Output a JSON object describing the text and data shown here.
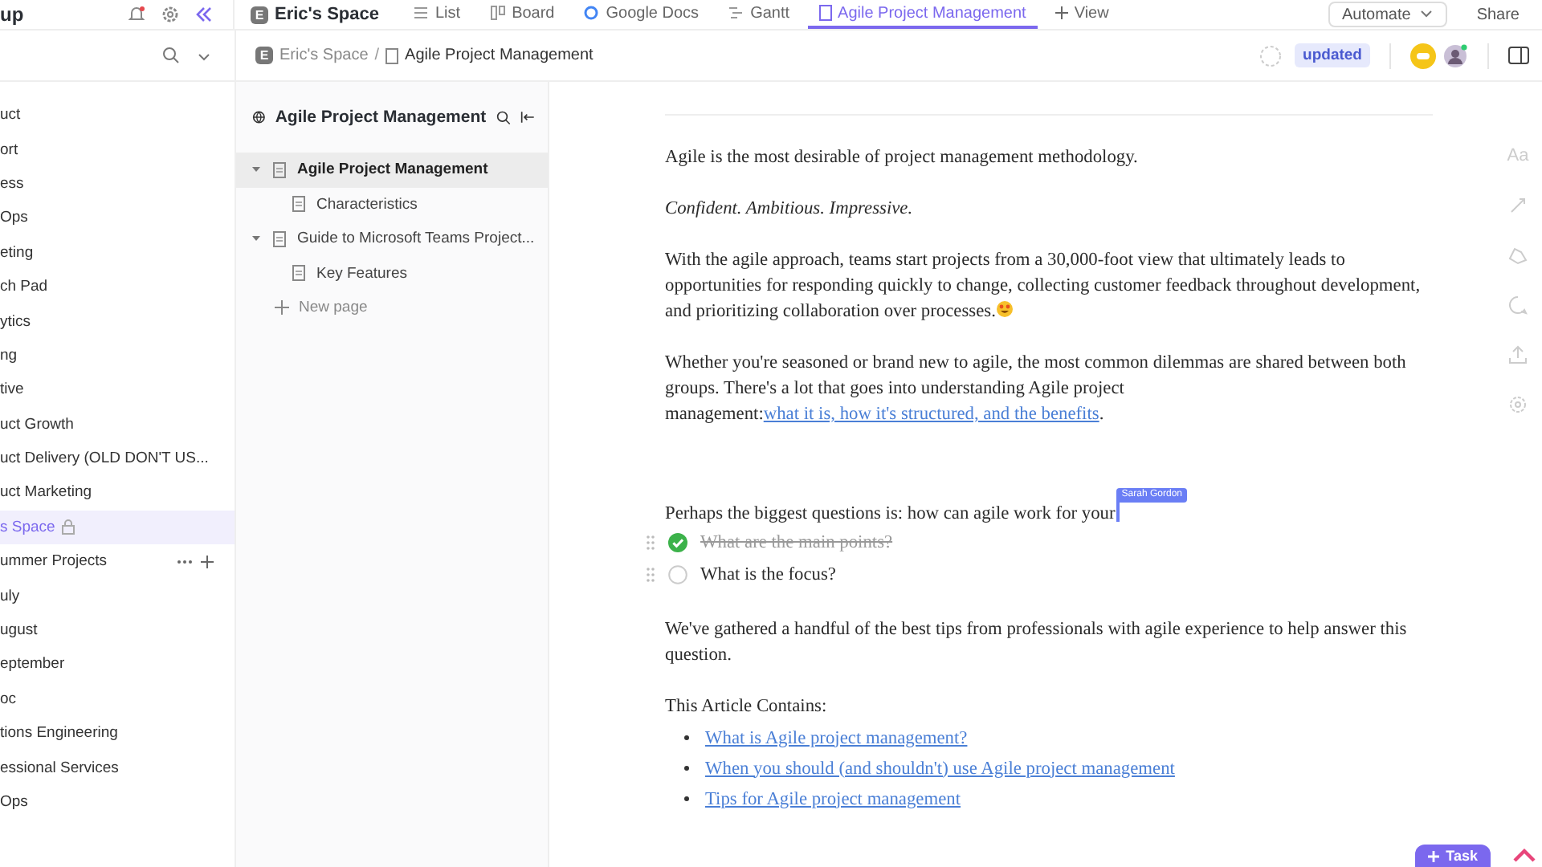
{
  "top_bar": {
    "logo_text": "up",
    "workspace": {
      "initial": "E",
      "name": "Eric's Space"
    },
    "views": [
      {
        "label": "List",
        "kind": "list",
        "selected": false
      },
      {
        "label": "Board",
        "kind": "board",
        "selected": false
      },
      {
        "label": "Google Docs",
        "kind": "gdocs",
        "selected": false
      },
      {
        "label": "Gantt",
        "kind": "gantt",
        "selected": false
      },
      {
        "label": "Agile Project Management",
        "kind": "doc",
        "selected": true
      }
    ],
    "add_view": "View",
    "automate": "Automate",
    "share": "Share"
  },
  "breadcrumb": {
    "space_initial": "E",
    "separator": "/",
    "items": [
      "Eric's Space",
      "Agile Project Management"
    ],
    "status": "updated"
  },
  "sidebar": {
    "items": [
      {
        "label": "uct",
        "selected": false,
        "locked": false,
        "hovered": false
      },
      {
        "label": "ort",
        "selected": false,
        "locked": false,
        "hovered": false
      },
      {
        "label": "ess",
        "selected": false,
        "locked": false,
        "hovered": false
      },
      {
        "label": "Ops",
        "selected": false,
        "locked": false,
        "hovered": false
      },
      {
        "label": "eting",
        "selected": false,
        "locked": false,
        "hovered": false
      },
      {
        "label": "ch Pad",
        "selected": false,
        "locked": false,
        "hovered": false
      },
      {
        "label": "ytics",
        "selected": false,
        "locked": false,
        "hovered": false
      },
      {
        "label": "ng",
        "selected": false,
        "locked": false,
        "hovered": false
      },
      {
        "label": "tive",
        "selected": false,
        "locked": false,
        "hovered": false
      },
      {
        "label": "uct Growth",
        "selected": false,
        "locked": false,
        "hovered": false
      },
      {
        "label": "uct Delivery (OLD DON'T US...",
        "selected": false,
        "locked": false,
        "hovered": false
      },
      {
        "label": "uct Marketing",
        "selected": false,
        "locked": false,
        "hovered": false
      },
      {
        "label": "s Space",
        "selected": true,
        "locked": true,
        "hovered": false
      },
      {
        "label": "ummer Projects",
        "selected": false,
        "locked": false,
        "hovered": true
      },
      {
        "label": "uly",
        "selected": false,
        "locked": false,
        "hovered": false
      },
      {
        "label": "ugust",
        "selected": false,
        "locked": false,
        "hovered": false
      },
      {
        "label": "eptember",
        "selected": false,
        "locked": false,
        "hovered": false
      },
      {
        "label": "oc",
        "selected": false,
        "locked": false,
        "hovered": false
      },
      {
        "label": "tions Engineering",
        "selected": false,
        "locked": false,
        "hovered": false
      },
      {
        "label": "essional Services",
        "selected": false,
        "locked": false,
        "hovered": false
      },
      {
        "label": "Ops",
        "selected": false,
        "locked": false,
        "hovered": false
      }
    ]
  },
  "page_tree": {
    "title": "Agile Project Management",
    "pages": [
      {
        "title": "Agile Project Management",
        "selected": true,
        "expanded": true,
        "children": [
          {
            "title": "Characteristics",
            "selected": false
          }
        ]
      },
      {
        "title": "Guide to Microsoft Teams Project...",
        "selected": false,
        "expanded": true,
        "children": [
          {
            "title": "Key Features",
            "selected": false
          }
        ]
      }
    ],
    "new_page": "New page"
  },
  "document": {
    "blocks": [
      {
        "kind": "paragraph",
        "text": "Agile is the most desirable of project management methodology.",
        "italic": false
      },
      {
        "kind": "paragraph",
        "text": "Confident. Ambitious. Impressive.",
        "italic": true
      },
      {
        "kind": "paragraph",
        "text": "With the agile approach, teams start projects from a 30,000-foot view that ultimately leads to opportunities for responding quickly to change, collecting customer feedback throughout development, and prioritizing collaboration over processes.",
        "italic": false,
        "emoji": true
      },
      {
        "kind": "paragraph",
        "text": "Whether you're seasoned or brand new to agile, the most common dilemmas are shared between both groups. There's a lot that goes into understanding Agile project management:",
        "italic": false,
        "link": "what it is, how it's structured, and the benefits",
        "after": "."
      },
      {
        "kind": "paragraph",
        "text": "Perhaps the biggest questions is: how can agile work for your",
        "italic": false,
        "cursor": "Sarah Gordon"
      },
      {
        "kind": "todo",
        "text": "What are the main points?",
        "checked": true
      },
      {
        "kind": "todo",
        "text": "What is the focus?",
        "checked": false
      },
      {
        "kind": "paragraph",
        "text": "We've gathered a handful of the best tips from professionals with agile experience to help answer this question.",
        "italic": false
      },
      {
        "kind": "paragraph",
        "text": "This Article Contains:",
        "italic": false
      },
      {
        "kind": "bullets",
        "items": [
          "What is Agile project management?",
          "When you should (and shouldn't) use Agile project management",
          "Tips for Agile project management"
        ]
      }
    ]
  },
  "right_rail": {
    "text_style": "Aa"
  },
  "task_button": "Task"
}
